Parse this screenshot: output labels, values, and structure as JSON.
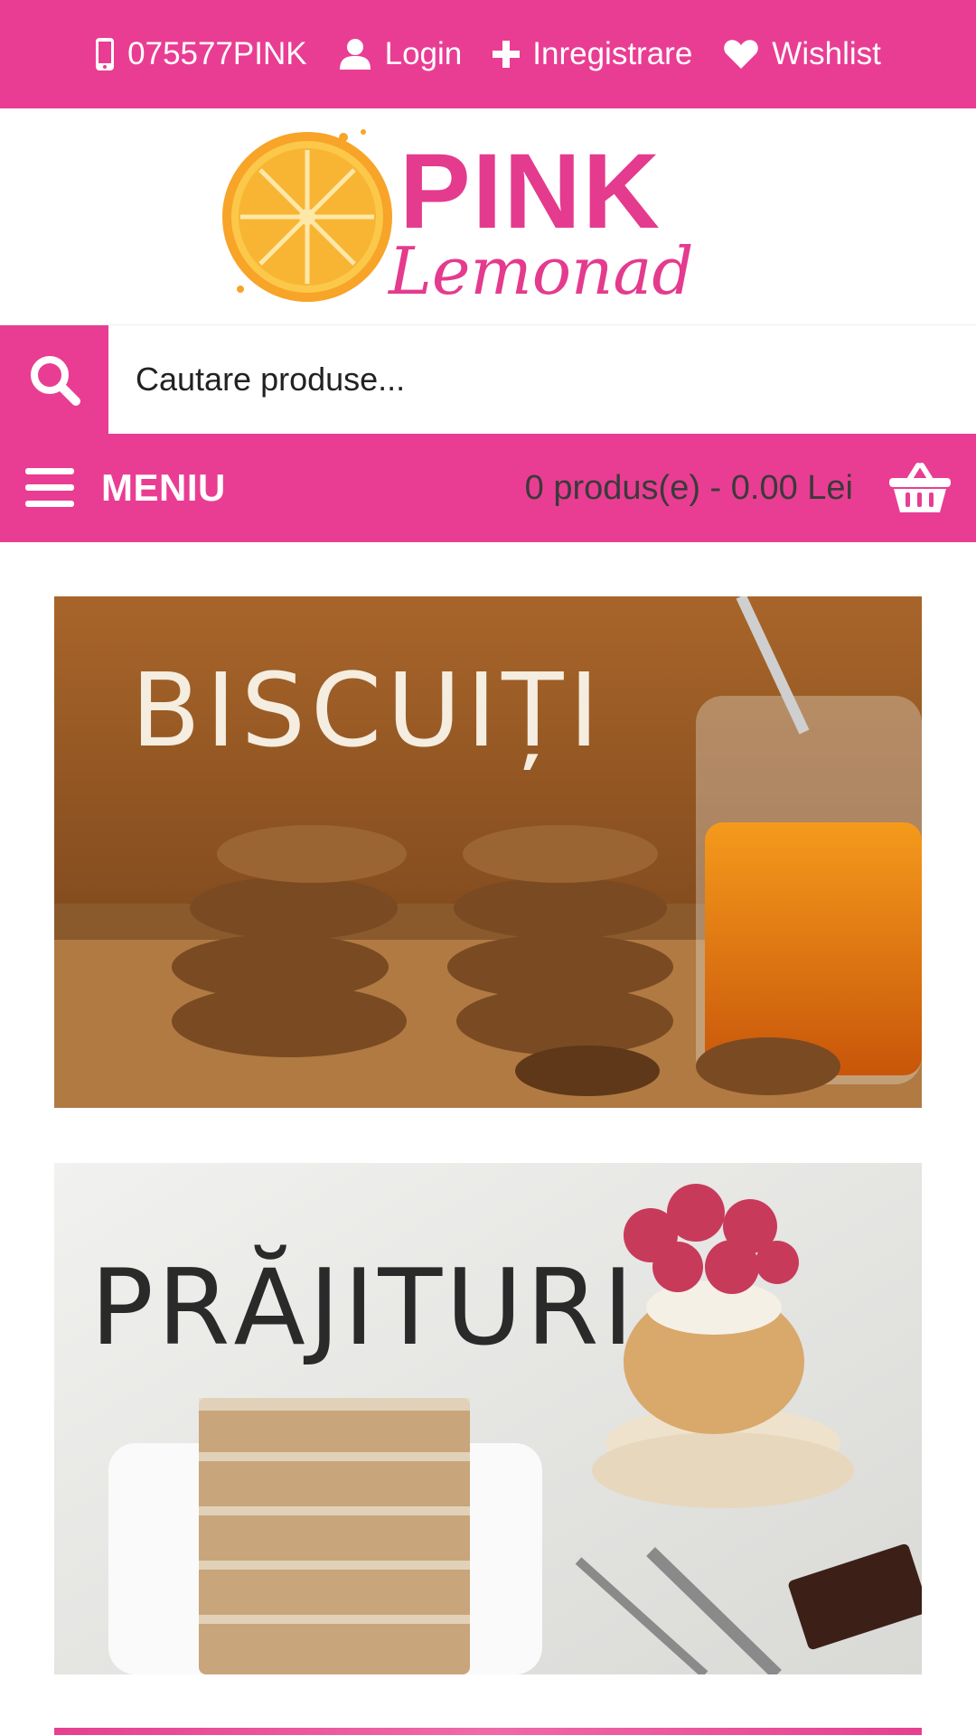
{
  "topbar": {
    "phone": "075577PINK",
    "login": "Login",
    "register": "Inregistrare",
    "wishlist": "Wishlist"
  },
  "logo": {
    "line1": "PINK",
    "line2": "Lemonade"
  },
  "search": {
    "placeholder": "Cautare produse..."
  },
  "menubar": {
    "menu_label": "MENIU",
    "cart_text": "0 produs(e) - 0.00 Lei"
  },
  "banners": [
    {
      "title": "BISCUIȚI"
    },
    {
      "title": "PRĂJITURI"
    }
  ],
  "colors": {
    "brand_pink": "#e93d93",
    "text_dark": "#3a3a3a",
    "white": "#ffffff"
  },
  "icons": [
    "phone-icon",
    "user-icon",
    "plus-icon",
    "heart-icon",
    "search-icon",
    "hamburger-icon",
    "basket-icon"
  ]
}
